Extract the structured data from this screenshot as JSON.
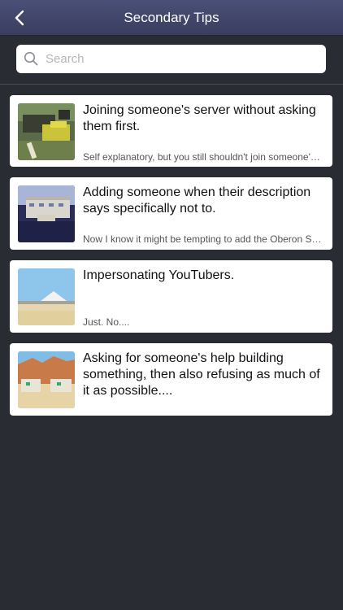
{
  "nav": {
    "title": "Secondary Tips",
    "back_icon": "chevron-left-icon"
  },
  "search": {
    "placeholder": "Search",
    "value": ""
  },
  "colors": {
    "nav_bar": "#3f4468",
    "background": "#2a2c34",
    "card": "#ffffff"
  },
  "tips": [
    {
      "title": "Joining someone's server without asking them first.",
      "subtitle": "Self explanatory, but you still shouldn't join someone's server without asking."
    },
    {
      "title": "Adding someone when their description says specifically not to.",
      "subtitle": "Now I know it might be tempting to add the Oberon Squad lead but please don't."
    },
    {
      "title": "Impersonating YouTubers.",
      "subtitle": "Just. No...."
    },
    {
      "title": "Asking for someone's help building something, then also refusing as much of it as possible....",
      "subtitle": ""
    }
  ]
}
